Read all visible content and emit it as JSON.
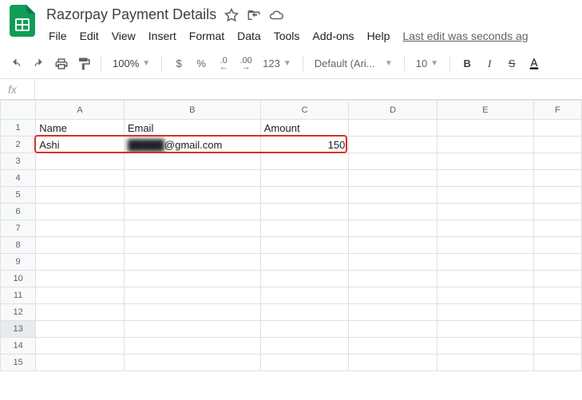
{
  "header": {
    "title": "Razorpay Payment Details",
    "last_edit": "Last edit was seconds ag"
  },
  "menus": {
    "file": "File",
    "edit": "Edit",
    "view": "View",
    "insert": "Insert",
    "format": "Format",
    "data": "Data",
    "tools": "Tools",
    "addons": "Add-ons",
    "help": "Help"
  },
  "toolbar": {
    "zoom": "100%",
    "currency": "$",
    "percent": "%",
    "dec_dec": ".0",
    "inc_dec": ".00",
    "num_format": "123",
    "font": "Default (Ari...",
    "font_size": "10",
    "bold": "B",
    "italic": "I",
    "strike": "S"
  },
  "fx": {
    "label": "fx"
  },
  "columns": {
    "A": "A",
    "B": "B",
    "C": "C",
    "D": "D",
    "E": "E",
    "F": "F"
  },
  "rows": {
    "r1": "1",
    "r2": "2",
    "r3": "3",
    "r4": "4",
    "r5": "5",
    "r6": "6",
    "r7": "7",
    "r8": "8",
    "r9": "9",
    "r10": "10",
    "r11": "11",
    "r12": "12",
    "r13": "13",
    "r14": "14",
    "r15": "15"
  },
  "cells": {
    "A1": "Name",
    "B1": "Email",
    "C1": "Amount",
    "A2": "Ashi",
    "B2_prefix": "█████",
    "B2_suffix": "@gmail.com",
    "C2": "150"
  }
}
